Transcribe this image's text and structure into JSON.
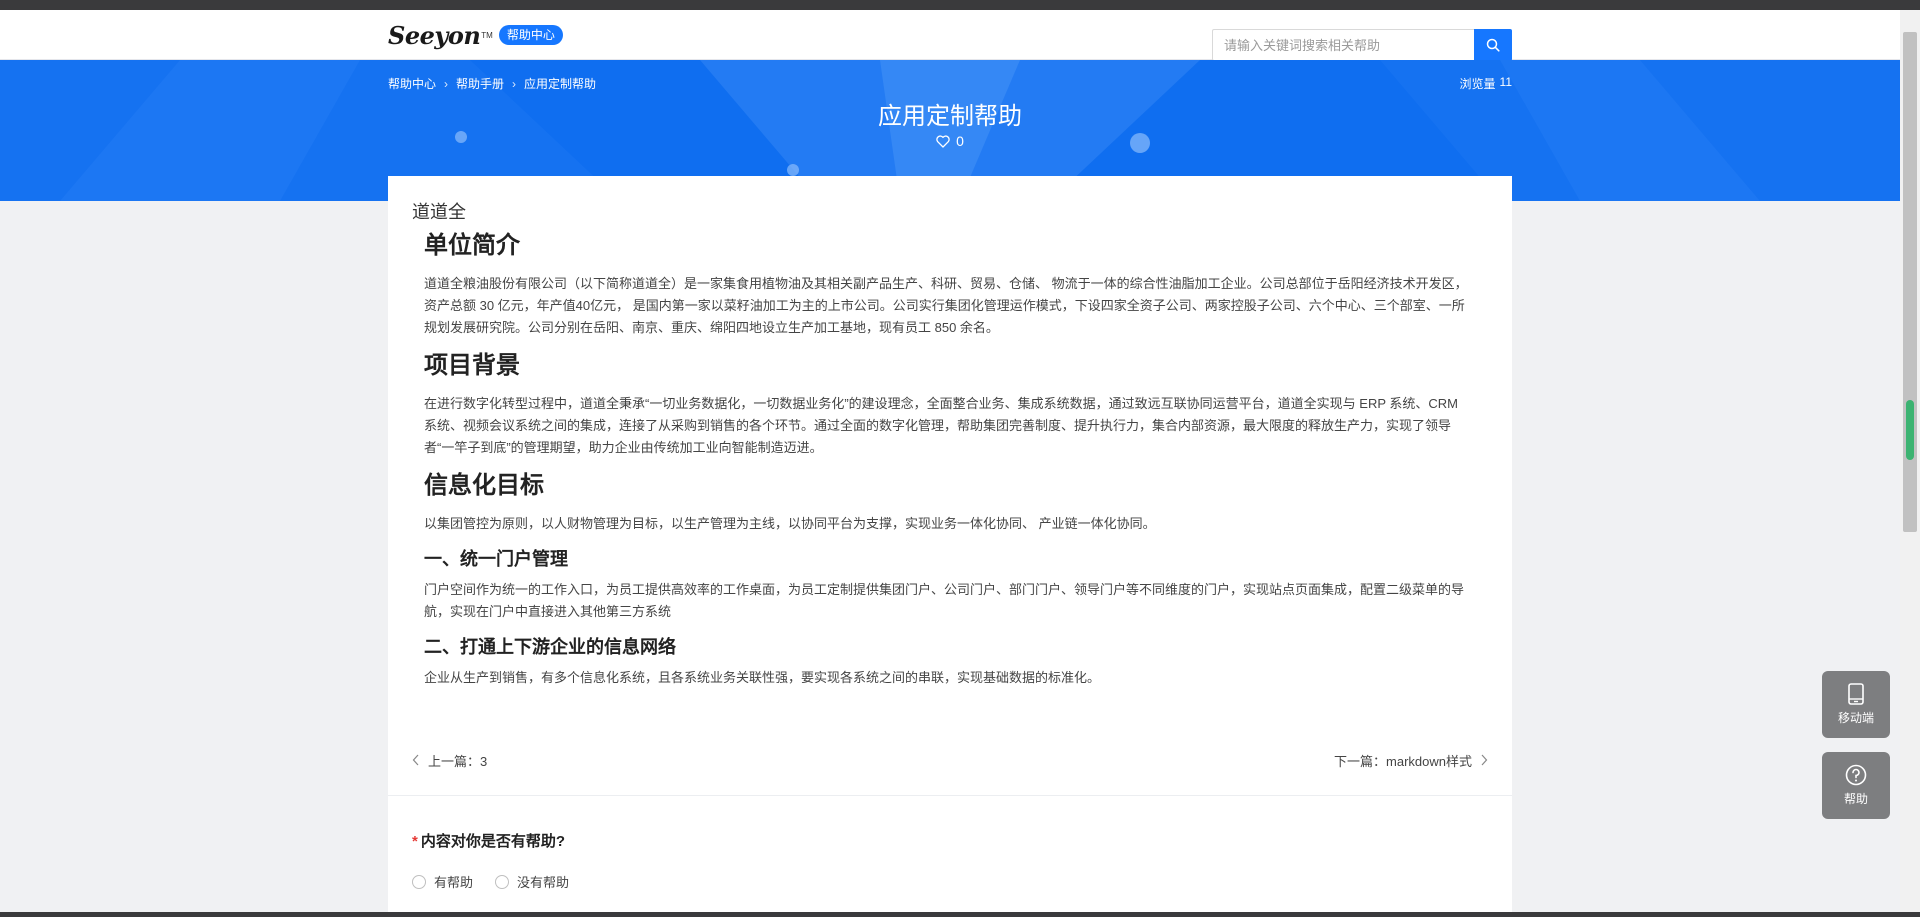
{
  "header": {
    "logo_text": "Seeyon",
    "logo_tm": "TM",
    "logo_badge": "帮助中心",
    "search_placeholder": "请输入关键词搜索相关帮助"
  },
  "banner": {
    "breadcrumb": [
      "帮助中心",
      "帮助手册",
      "应用定制帮助"
    ],
    "views_label": "浏览量",
    "views_count": "11",
    "title": "应用定制帮助",
    "likes": "0"
  },
  "article": {
    "doc_name": "道道全",
    "sections": [
      {
        "heading": "单位简介",
        "text": "道道全粮油股份有限公司（以下简称道道全）是一家集食用植物油及其相关副产品生产、科研、贸易、仓储、 物流于一体的综合性油脂加工企业。公司总部位于岳阳经济技术开发区，资产总额 30 亿元，年产值40亿元， 是国内第一家以菜籽油加工为主的上市公司。公司实行集团化管理运作模式，下设四家全资子公司、两家控股子公司、六个中心、三个部室、一所规划发展研究院。公司分别在岳阳、南京、重庆、绵阳四地设立生产加工基地，现有员工 850 余名。"
      },
      {
        "heading": "项目背景",
        "text": "在进行数字化转型过程中，道道全秉承“一切业务数据化，一切数据业务化”的建设理念，全面整合业务、集成系统数据，通过致远互联协同运营平台，道道全实现与 ERP 系统、CRM 系统、视频会议系统之间的集成，连接了从采购到销售的各个环节。通过全面的数字化管理，帮助集团完善制度、提升执行力，集合内部资源，最大限度的释放生产力，实现了领导者“一竿子到底”的管理期望，助力企业由传统加工业向智能制造迈进。"
      },
      {
        "heading": "信息化目标",
        "text": "以集团管控为原则，以人财物管理为目标，以生产管理为主线，以协同平台为支撑，实现业务一体化协同、 产业链一体化协同。"
      }
    ],
    "subsections": [
      {
        "heading": "一、统一门户管理",
        "text": "门户空间作为统一的工作入口，为员工提供高效率的工作桌面，为员工定制提供集团门户、公司门户、部门门户、领导门户等不同维度的门户，实现站点页面集成，配置二级菜单的导航，实现在门户中直接进入其他第三方系统"
      },
      {
        "heading": "二、打通上下游企业的信息网络",
        "text": "企业从生产到销售，有多个信息化系统，且各系统业务关联性强，要实现各系统之间的串联，实现基础数据的标准化。"
      }
    ]
  },
  "pager": {
    "prev": "上一篇：3",
    "next": "下一篇：markdown样式"
  },
  "feedback": {
    "required_mark": "*",
    "question": "内容对你是否有帮助?",
    "options": [
      "有帮助",
      "没有帮助"
    ]
  },
  "float_buttons": {
    "mobile": "移动端",
    "help": "帮助"
  },
  "colors": {
    "brand_blue": "#1677ff",
    "banner_blue": "#0f6ef0",
    "float_gray": "#7d7e80"
  }
}
